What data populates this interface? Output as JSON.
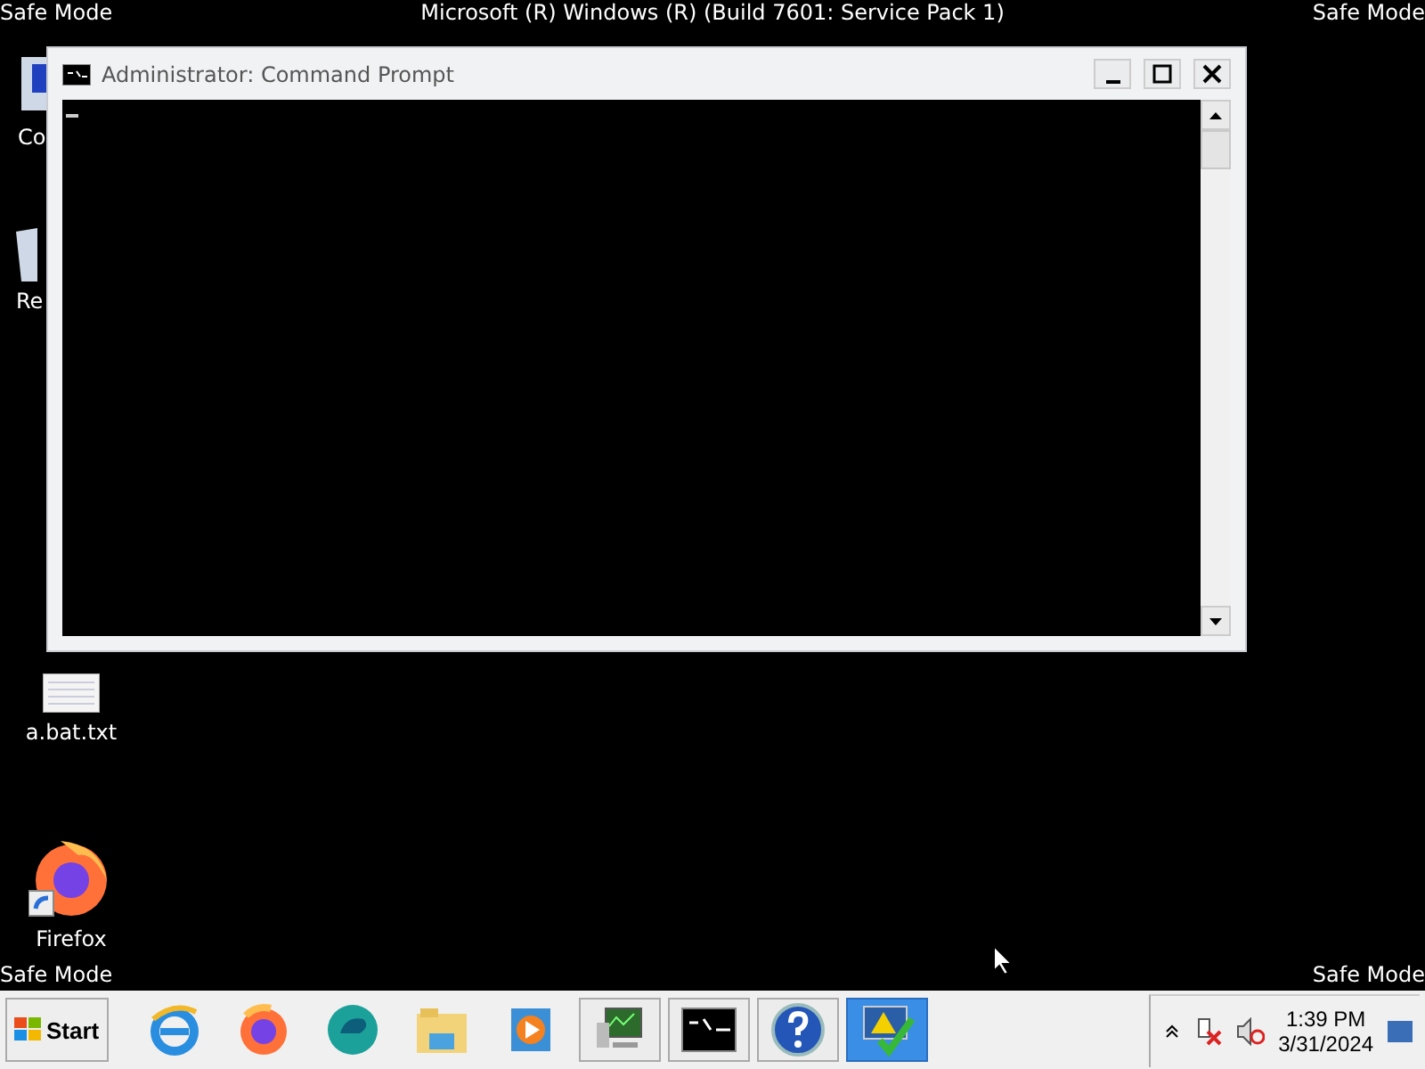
{
  "top_bar": {
    "left": "Safe Mode",
    "title": "Microsoft (R) Windows (R) (Build 7601: Service Pack 1)",
    "right": "Safe Mode"
  },
  "desktop_icons": [
    {
      "kind": "computer",
      "label": "Co"
    },
    {
      "kind": "recycle",
      "label": "Re"
    },
    {
      "kind": "textfile",
      "label": "a.bat.txt"
    },
    {
      "kind": "firefox",
      "label": "Firefox"
    }
  ],
  "window": {
    "title": "Administrator:  Command Prompt"
  },
  "bottom_bar": {
    "left": "Safe Mode",
    "right": "Safe Mode"
  },
  "taskbar": {
    "start": "Start",
    "items": [
      {
        "kind": "ie",
        "framed": false,
        "selected": false
      },
      {
        "kind": "firefox",
        "framed": false,
        "selected": false
      },
      {
        "kind": "edge",
        "framed": false,
        "selected": false
      },
      {
        "kind": "explorer",
        "framed": false,
        "selected": false
      },
      {
        "kind": "media",
        "framed": false,
        "selected": false
      },
      {
        "kind": "taskmgr",
        "framed": true,
        "selected": false
      },
      {
        "kind": "cmd",
        "framed": true,
        "selected": false
      },
      {
        "kind": "help",
        "framed": true,
        "selected": false
      },
      {
        "kind": "action",
        "framed": true,
        "selected": true
      }
    ],
    "time": "1:39 PM",
    "date": "3/31/2024"
  }
}
